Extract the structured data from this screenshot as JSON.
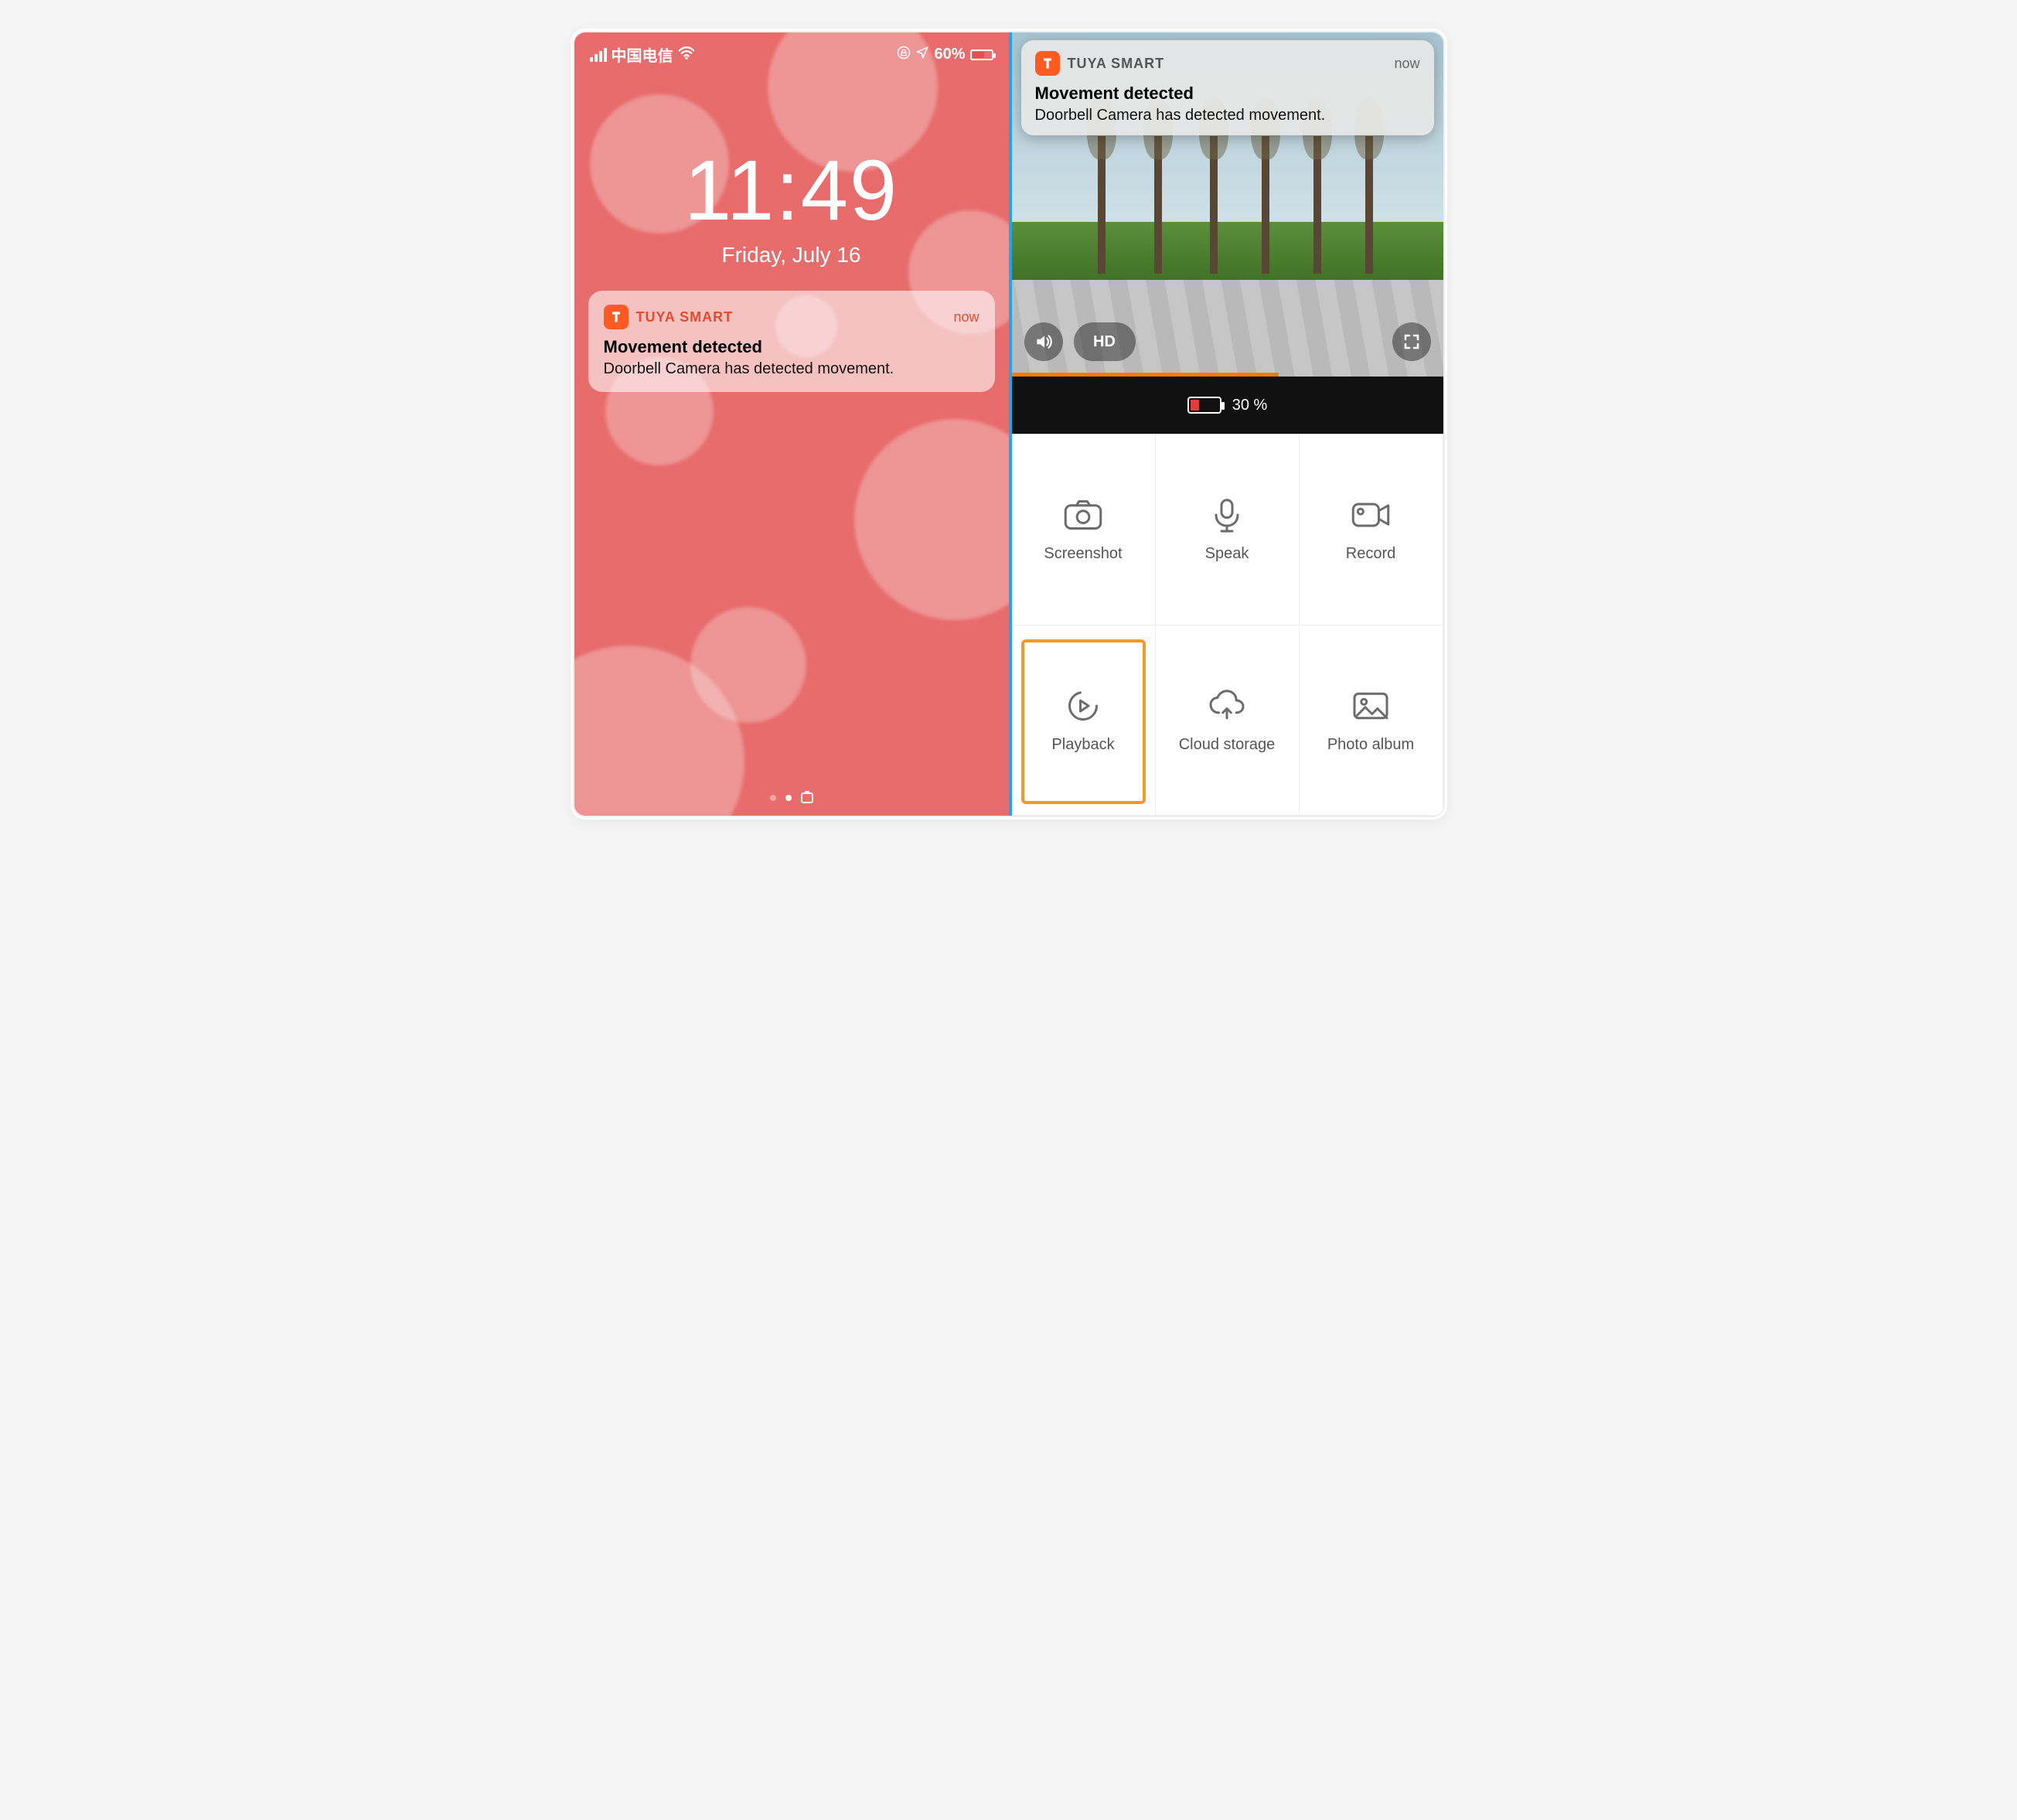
{
  "lock": {
    "carrier": "中国电信",
    "battery_pct": "60%",
    "time": "11:49",
    "date": "Friday, July 16",
    "notification": {
      "app": "TUYA SMART",
      "when": "now",
      "title": "Movement detected",
      "body": "Doorbell Camera has detected movement."
    }
  },
  "app": {
    "notification": {
      "app": "TUYA SMART",
      "when": "now",
      "title": "Movement detected",
      "body": "Doorbell Camera has detected movement."
    },
    "quality_label": "HD",
    "device_battery": "30 %",
    "actions": {
      "screenshot": "Screenshot",
      "speak": "Speak",
      "record": "Record",
      "playback": "Playback",
      "cloud": "Cloud storage",
      "album": "Photo album"
    }
  }
}
